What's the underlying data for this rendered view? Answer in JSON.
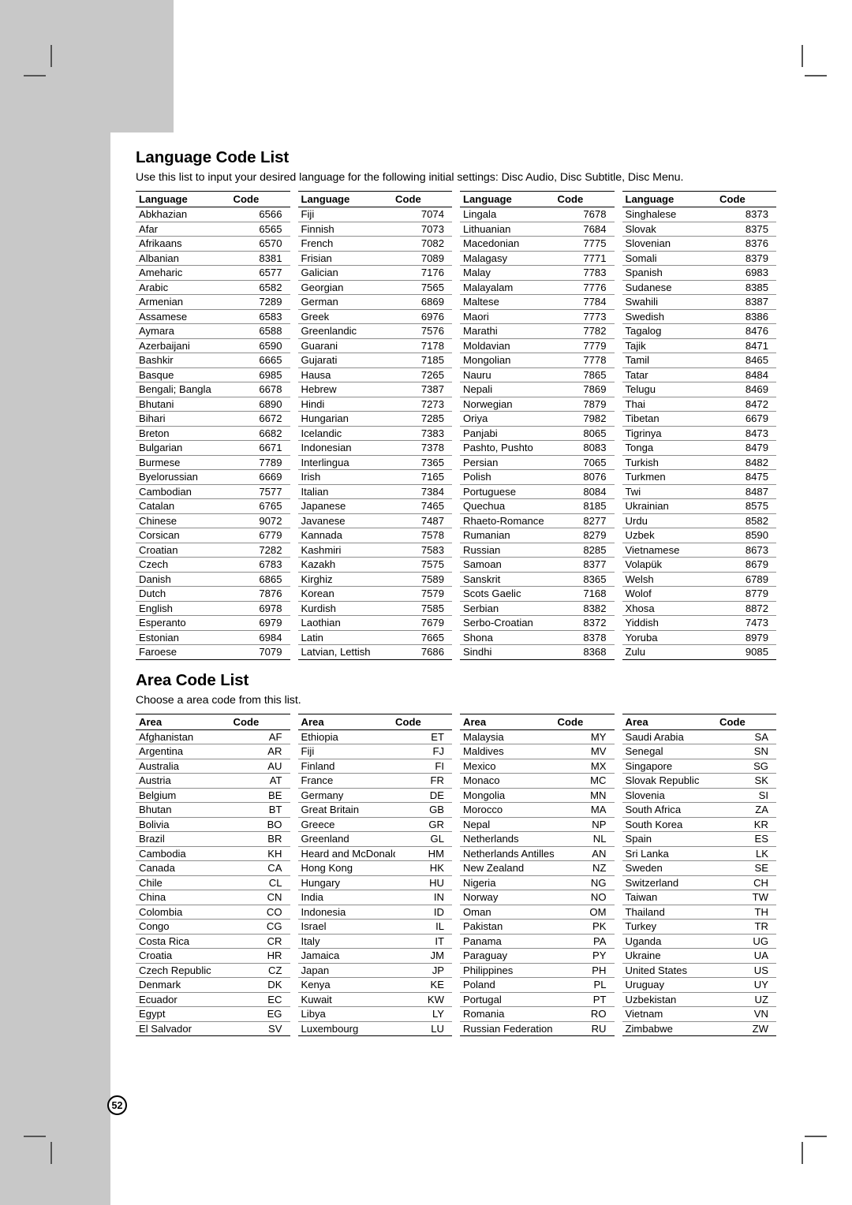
{
  "page": {
    "number": "52"
  },
  "language_section": {
    "title": "Language Code List",
    "description": "Use this list to input your desired language for the following initial settings: Disc Audio, Disc Subtitle, Disc Menu.",
    "headers": {
      "name": "Language",
      "code": "Code"
    },
    "columns": [
      [
        [
          "Abkhazian",
          "6566"
        ],
        [
          "Afar",
          "6565"
        ],
        [
          "Afrikaans",
          "6570"
        ],
        [
          "Albanian",
          "8381"
        ],
        [
          "Ameharic",
          "6577"
        ],
        [
          "Arabic",
          "6582"
        ],
        [
          "Armenian",
          "7289"
        ],
        [
          "Assamese",
          "6583"
        ],
        [
          "Aymara",
          "6588"
        ],
        [
          "Azerbaijani",
          "6590"
        ],
        [
          "Bashkir",
          "6665"
        ],
        [
          "Basque",
          "6985"
        ],
        [
          "Bengali; Bangla",
          "6678"
        ],
        [
          "Bhutani",
          "6890"
        ],
        [
          "Bihari",
          "6672"
        ],
        [
          "Breton",
          "6682"
        ],
        [
          "Bulgarian",
          "6671"
        ],
        [
          "Burmese",
          "7789"
        ],
        [
          "Byelorussian",
          "6669"
        ],
        [
          "Cambodian",
          "7577"
        ],
        [
          "Catalan",
          "6765"
        ],
        [
          "Chinese",
          "9072"
        ],
        [
          "Corsican",
          "6779"
        ],
        [
          "Croatian",
          "7282"
        ],
        [
          "Czech",
          "6783"
        ],
        [
          "Danish",
          "6865"
        ],
        [
          "Dutch",
          "7876"
        ],
        [
          "English",
          "6978"
        ],
        [
          "Esperanto",
          "6979"
        ],
        [
          "Estonian",
          "6984"
        ],
        [
          "Faroese",
          "7079"
        ]
      ],
      [
        [
          "Fiji",
          "7074"
        ],
        [
          "Finnish",
          "7073"
        ],
        [
          "French",
          "7082"
        ],
        [
          "Frisian",
          "7089"
        ],
        [
          "Galician",
          "7176"
        ],
        [
          "Georgian",
          "7565"
        ],
        [
          "German",
          "6869"
        ],
        [
          "Greek",
          "6976"
        ],
        [
          "Greenlandic",
          "7576"
        ],
        [
          "Guarani",
          "7178"
        ],
        [
          "Gujarati",
          "7185"
        ],
        [
          "Hausa",
          "7265"
        ],
        [
          "Hebrew",
          "7387"
        ],
        [
          "Hindi",
          "7273"
        ],
        [
          "Hungarian",
          "7285"
        ],
        [
          "Icelandic",
          "7383"
        ],
        [
          "Indonesian",
          "7378"
        ],
        [
          "Interlingua",
          "7365"
        ],
        [
          "Irish",
          "7165"
        ],
        [
          "Italian",
          "7384"
        ],
        [
          "Japanese",
          "7465"
        ],
        [
          "Javanese",
          "7487"
        ],
        [
          "Kannada",
          "7578"
        ],
        [
          "Kashmiri",
          "7583"
        ],
        [
          "Kazakh",
          "7575"
        ],
        [
          "Kirghiz",
          "7589"
        ],
        [
          "Korean",
          "7579"
        ],
        [
          "Kurdish",
          "7585"
        ],
        [
          "Laothian",
          "7679"
        ],
        [
          "Latin",
          "7665"
        ],
        [
          "Latvian, Lettish",
          "7686"
        ]
      ],
      [
        [
          "Lingala",
          "7678"
        ],
        [
          "Lithuanian",
          "7684"
        ],
        [
          "Macedonian",
          "7775"
        ],
        [
          "Malagasy",
          "7771"
        ],
        [
          "Malay",
          "7783"
        ],
        [
          "Malayalam",
          "7776"
        ],
        [
          "Maltese",
          "7784"
        ],
        [
          "Maori",
          "7773"
        ],
        [
          "Marathi",
          "7782"
        ],
        [
          "Moldavian",
          "7779"
        ],
        [
          "Mongolian",
          "7778"
        ],
        [
          "Nauru",
          "7865"
        ],
        [
          "Nepali",
          "7869"
        ],
        [
          "Norwegian",
          "7879"
        ],
        [
          "Oriya",
          "7982"
        ],
        [
          "Panjabi",
          "8065"
        ],
        [
          "Pashto, Pushto",
          "8083"
        ],
        [
          "Persian",
          "7065"
        ],
        [
          "Polish",
          "8076"
        ],
        [
          "Portuguese",
          "8084"
        ],
        [
          "Quechua",
          "8185"
        ],
        [
          "Rhaeto-Romance",
          "8277"
        ],
        [
          "Rumanian",
          "8279"
        ],
        [
          "Russian",
          "8285"
        ],
        [
          "Samoan",
          "8377"
        ],
        [
          "Sanskrit",
          "8365"
        ],
        [
          "Scots Gaelic",
          "7168"
        ],
        [
          "Serbian",
          "8382"
        ],
        [
          "Serbo-Croatian",
          "8372"
        ],
        [
          "Shona",
          "8378"
        ],
        [
          "Sindhi",
          "8368"
        ]
      ],
      [
        [
          "Singhalese",
          "8373"
        ],
        [
          "Slovak",
          "8375"
        ],
        [
          "Slovenian",
          "8376"
        ],
        [
          "Somali",
          "8379"
        ],
        [
          "Spanish",
          "6983"
        ],
        [
          "Sudanese",
          "8385"
        ],
        [
          "Swahili",
          "8387"
        ],
        [
          "Swedish",
          "8386"
        ],
        [
          "Tagalog",
          "8476"
        ],
        [
          "Tajik",
          "8471"
        ],
        [
          "Tamil",
          "8465"
        ],
        [
          "Tatar",
          "8484"
        ],
        [
          "Telugu",
          "8469"
        ],
        [
          "Thai",
          "8472"
        ],
        [
          "Tibetan",
          "6679"
        ],
        [
          "Tigrinya",
          "8473"
        ],
        [
          "Tonga",
          "8479"
        ],
        [
          "Turkish",
          "8482"
        ],
        [
          "Turkmen",
          "8475"
        ],
        [
          "Twi",
          "8487"
        ],
        [
          "Ukrainian",
          "8575"
        ],
        [
          "Urdu",
          "8582"
        ],
        [
          "Uzbek",
          "8590"
        ],
        [
          "Vietnamese",
          "8673"
        ],
        [
          "Volapük",
          "8679"
        ],
        [
          "Welsh",
          "6789"
        ],
        [
          "Wolof",
          "8779"
        ],
        [
          "Xhosa",
          "8872"
        ],
        [
          "Yiddish",
          "7473"
        ],
        [
          "Yoruba",
          "8979"
        ],
        [
          "Zulu",
          "9085"
        ]
      ]
    ]
  },
  "area_section": {
    "title": "Area Code List",
    "description": "Choose a area code from this list.",
    "headers": {
      "name": "Area",
      "code": "Code"
    },
    "columns": [
      [
        [
          "Afghanistan",
          "AF"
        ],
        [
          "Argentina",
          "AR"
        ],
        [
          "Australia",
          "AU"
        ],
        [
          "Austria",
          "AT"
        ],
        [
          "Belgium",
          "BE"
        ],
        [
          "Bhutan",
          "BT"
        ],
        [
          "Bolivia",
          "BO"
        ],
        [
          "Brazil",
          "BR"
        ],
        [
          "Cambodia",
          "KH"
        ],
        [
          "Canada",
          "CA"
        ],
        [
          "Chile",
          "CL"
        ],
        [
          "China",
          "CN"
        ],
        [
          "Colombia",
          "CO"
        ],
        [
          "Congo",
          "CG"
        ],
        [
          "Costa Rica",
          "CR"
        ],
        [
          "Croatia",
          "HR"
        ],
        [
          "Czech Republic",
          "CZ"
        ],
        [
          "Denmark",
          "DK"
        ],
        [
          "Ecuador",
          "EC"
        ],
        [
          "Egypt",
          "EG"
        ],
        [
          "El Salvador",
          "SV"
        ]
      ],
      [
        [
          "Ethiopia",
          "ET"
        ],
        [
          "Fiji",
          "FJ"
        ],
        [
          "Finland",
          "FI"
        ],
        [
          "France",
          "FR"
        ],
        [
          "Germany",
          "DE"
        ],
        [
          "Great Britain",
          "GB"
        ],
        [
          "Greece",
          "GR"
        ],
        [
          "Greenland",
          "GL"
        ],
        [
          "Heard and McDonald Islands",
          "HM"
        ],
        [
          "Hong Kong",
          "HK"
        ],
        [
          "Hungary",
          "HU"
        ],
        [
          "India",
          "IN"
        ],
        [
          "Indonesia",
          "ID"
        ],
        [
          "Israel",
          "IL"
        ],
        [
          "Italy",
          "IT"
        ],
        [
          "Jamaica",
          "JM"
        ],
        [
          "Japan",
          "JP"
        ],
        [
          "Kenya",
          "KE"
        ],
        [
          "Kuwait",
          "KW"
        ],
        [
          "Libya",
          "LY"
        ],
        [
          "Luxembourg",
          "LU"
        ]
      ],
      [
        [
          "Malaysia",
          "MY"
        ],
        [
          "Maldives",
          "MV"
        ],
        [
          "Mexico",
          "MX"
        ],
        [
          "Monaco",
          "MC"
        ],
        [
          "Mongolia",
          "MN"
        ],
        [
          "Morocco",
          "MA"
        ],
        [
          "Nepal",
          "NP"
        ],
        [
          "Netherlands",
          "NL"
        ],
        [
          "Netherlands Antilles",
          "AN"
        ],
        [
          "New Zealand",
          "NZ"
        ],
        [
          "Nigeria",
          "NG"
        ],
        [
          "Norway",
          "NO"
        ],
        [
          "Oman",
          "OM"
        ],
        [
          "Pakistan",
          "PK"
        ],
        [
          "Panama",
          "PA"
        ],
        [
          "Paraguay",
          "PY"
        ],
        [
          "Philippines",
          "PH"
        ],
        [
          "Poland",
          "PL"
        ],
        [
          "Portugal",
          "PT"
        ],
        [
          "Romania",
          "RO"
        ],
        [
          "Russian Federation",
          "RU"
        ]
      ],
      [
        [
          "Saudi Arabia",
          "SA"
        ],
        [
          "Senegal",
          "SN"
        ],
        [
          "Singapore",
          "SG"
        ],
        [
          "Slovak Republic",
          "SK"
        ],
        [
          "Slovenia",
          "SI"
        ],
        [
          "South Africa",
          "ZA"
        ],
        [
          "South Korea",
          "KR"
        ],
        [
          "Spain",
          "ES"
        ],
        [
          "Sri Lanka",
          "LK"
        ],
        [
          "Sweden",
          "SE"
        ],
        [
          "Switzerland",
          "CH"
        ],
        [
          "Taiwan",
          "TW"
        ],
        [
          "Thailand",
          "TH"
        ],
        [
          "Turkey",
          "TR"
        ],
        [
          "Uganda",
          "UG"
        ],
        [
          "Ukraine",
          "UA"
        ],
        [
          "United States",
          "US"
        ],
        [
          "Uruguay",
          "UY"
        ],
        [
          "Uzbekistan",
          "UZ"
        ],
        [
          "Vietnam",
          "VN"
        ],
        [
          "Zimbabwe",
          "ZW"
        ]
      ]
    ]
  }
}
